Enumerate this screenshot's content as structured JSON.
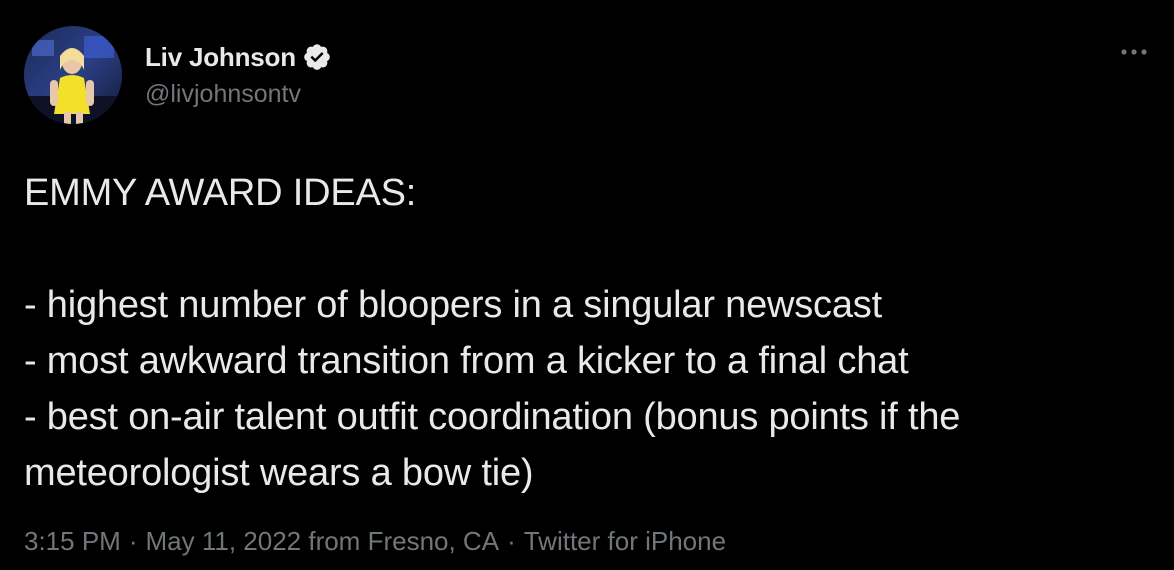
{
  "author": {
    "display_name": "Liv Johnson",
    "handle": "@livjohnsontv",
    "verified": true,
    "verified_color": "#e7e9ea"
  },
  "tweet": {
    "text": "EMMY AWARD IDEAS:\n\n- highest number of bloopers in a singular newscast\n- most awkward transition from a kicker to a final chat\n- best on-air talent outfit coordination (bonus points if the meteorologist wears a bow tie)"
  },
  "meta": {
    "time": "3:15 PM",
    "separator": "·",
    "date_location": "May 11, 2022 from Fresno, CA",
    "source": "Twitter for iPhone"
  },
  "icons": {
    "more": "more-horizontal-icon",
    "verified": "verified-badge-icon"
  },
  "colors": {
    "background": "#000000",
    "primary_text": "#e7e9ea",
    "secondary_text": "#71767b"
  }
}
